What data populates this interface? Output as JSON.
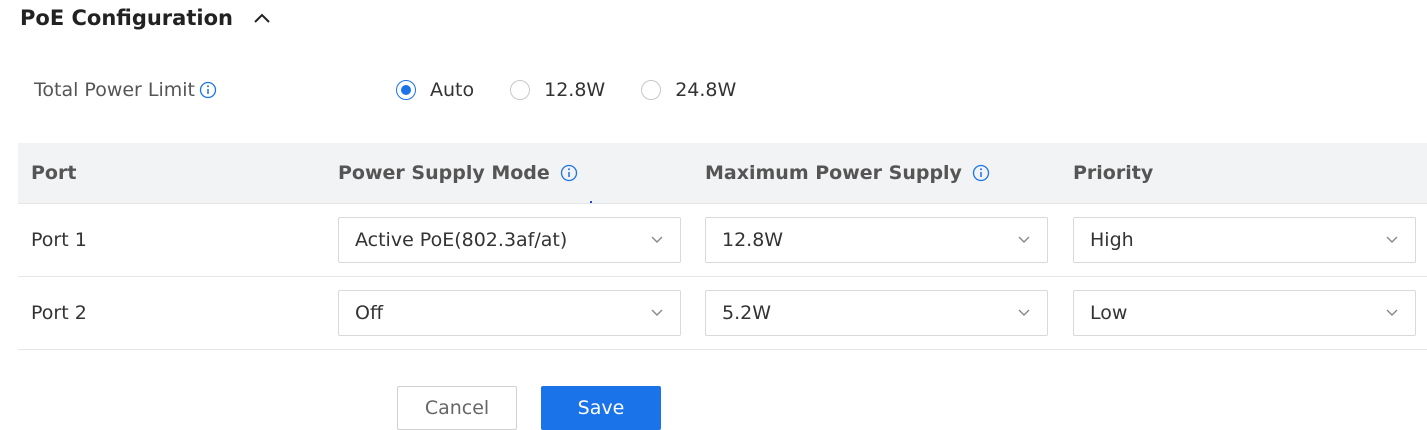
{
  "section": {
    "title": "PoE Configuration"
  },
  "power_limit": {
    "label": "Total Power Limit",
    "options": [
      "Auto",
      "12.8W",
      "24.8W"
    ],
    "selected": "Auto"
  },
  "table": {
    "headers": {
      "port": "Port",
      "mode": "Power Supply Mode",
      "max_power": "Maximum Power Supply",
      "priority": "Priority"
    },
    "rows": [
      {
        "port": "Port 1",
        "mode": "Active PoE(802.3af/at)",
        "max_power": "12.8W",
        "priority": "High"
      },
      {
        "port": "Port 2",
        "mode": "Off",
        "max_power": "5.2W",
        "priority": "Low"
      }
    ]
  },
  "buttons": {
    "cancel": "Cancel",
    "save": "Save"
  },
  "colors": {
    "accent": "#1a73e8",
    "header_bg": "#f2f3f5"
  },
  "icons": {
    "collapse": "chevron-up-icon",
    "info": "info-icon",
    "dropdown": "chevron-down-icon"
  }
}
